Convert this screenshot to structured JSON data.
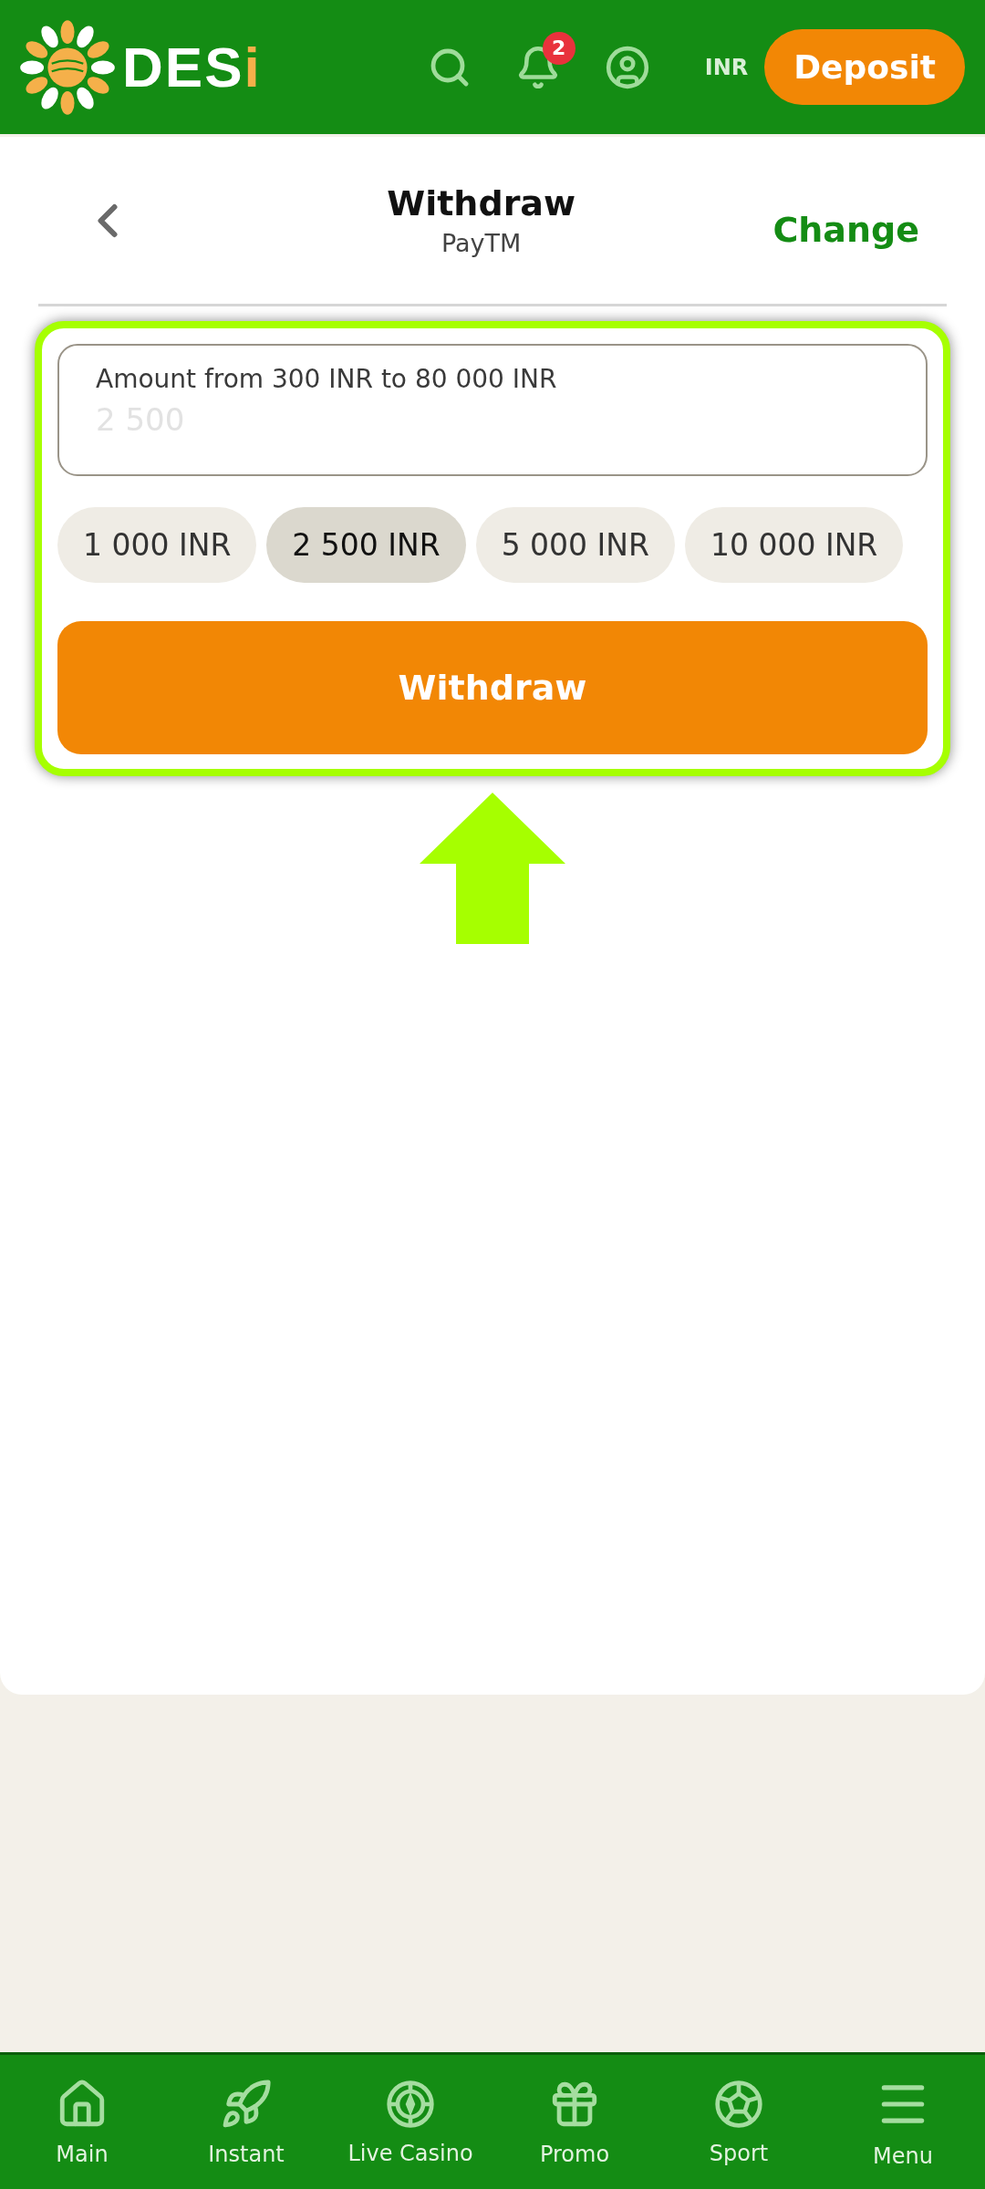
{
  "header": {
    "logo": {
      "text": "DES",
      "accent": "i"
    },
    "notifications": "2",
    "currency": "INR",
    "deposit": "Deposit"
  },
  "page": {
    "title": "Withdraw",
    "subtitle": "PayTM",
    "change": "Change"
  },
  "form": {
    "label": "Amount from 300 INR to 80 000 INR",
    "value": "2 500",
    "presets": [
      {
        "label": "1 000 INR",
        "selected": false
      },
      {
        "label": "2 500 INR",
        "selected": true
      },
      {
        "label": "5 000 INR",
        "selected": false
      },
      {
        "label": "10 000 INR",
        "selected": false
      }
    ],
    "submit": "Withdraw"
  },
  "nav": [
    {
      "kind": "home",
      "label": "Main"
    },
    {
      "kind": "rocket",
      "label": "Instant"
    },
    {
      "kind": "chip",
      "label": "Live Casino"
    },
    {
      "kind": "gift",
      "label": "Promo"
    },
    {
      "kind": "ball",
      "label": "Sport"
    },
    {
      "kind": "menu",
      "label": "Menu"
    }
  ]
}
